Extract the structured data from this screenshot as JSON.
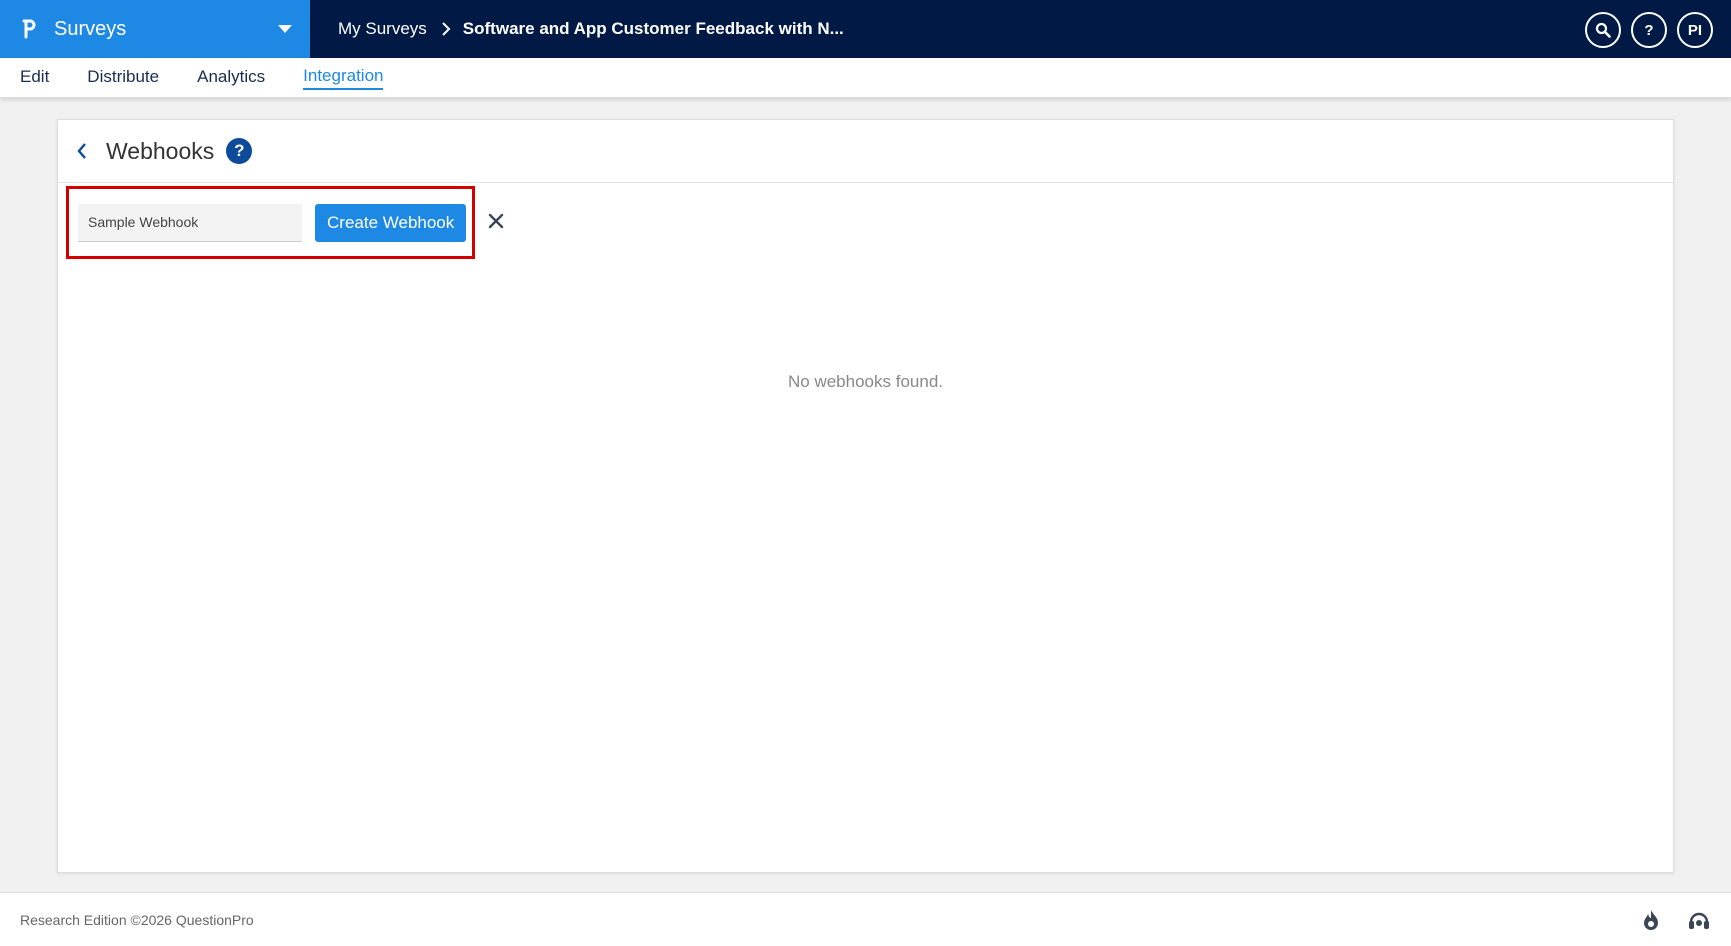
{
  "app": {
    "product_name": "Surveys"
  },
  "breadcrumb": {
    "parent": "My Surveys",
    "current": "Software and App Customer Feedback with N..."
  },
  "top_actions": {
    "search_icon": "search-icon",
    "help_label": "?",
    "user_initials": "PI"
  },
  "subnav": {
    "items": [
      {
        "label": "Edit",
        "active": false
      },
      {
        "label": "Distribute",
        "active": false
      },
      {
        "label": "Analytics",
        "active": false
      },
      {
        "label": "Integration",
        "active": true
      }
    ]
  },
  "webhooks": {
    "title": "Webhooks",
    "help_label": "?",
    "name_input_value": "Sample Webhook",
    "create_button_label": "Create Webhook",
    "empty_message": "No webhooks found."
  },
  "footer": {
    "copyright": "Research Edition ©2026 QuestionPro"
  },
  "colors": {
    "topbar_bg": "#001a45",
    "brand_blue": "#1e88e5",
    "help_badge": "#0d4a9a",
    "highlight_border": "#d40000"
  }
}
